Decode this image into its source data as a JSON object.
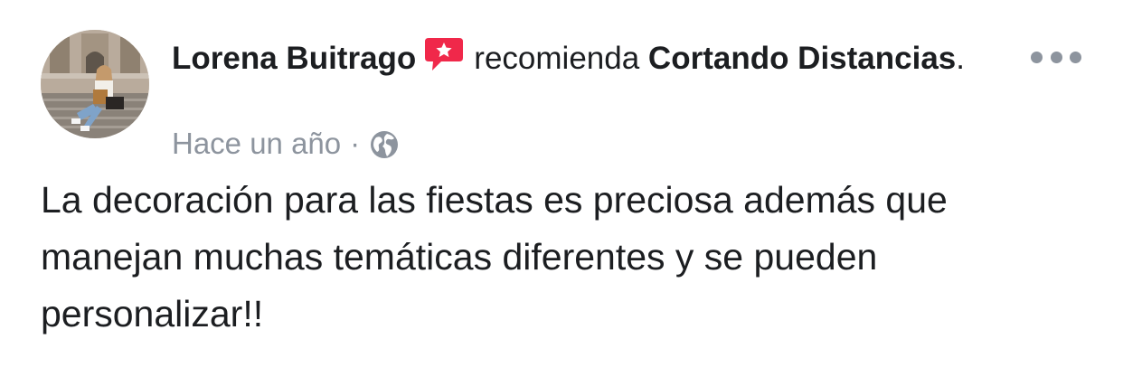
{
  "post": {
    "author": "Lorena Buitrago",
    "verb": "recomienda",
    "page": "Cortando Distancias",
    "period": ".",
    "time": "Hace un año",
    "separator": "·",
    "privacy_icon": "globe-icon",
    "recommend_icon": "recommend-star-icon",
    "more_icon": "more-options-icon",
    "text": "La decoración para las fiestas es preciosa además que manejan muchas temáticas diferentes y se pueden personalizar!!"
  },
  "colors": {
    "recommend_badge": "#f0284a",
    "meta_text": "#8d949e",
    "text": "#1c1e21"
  }
}
